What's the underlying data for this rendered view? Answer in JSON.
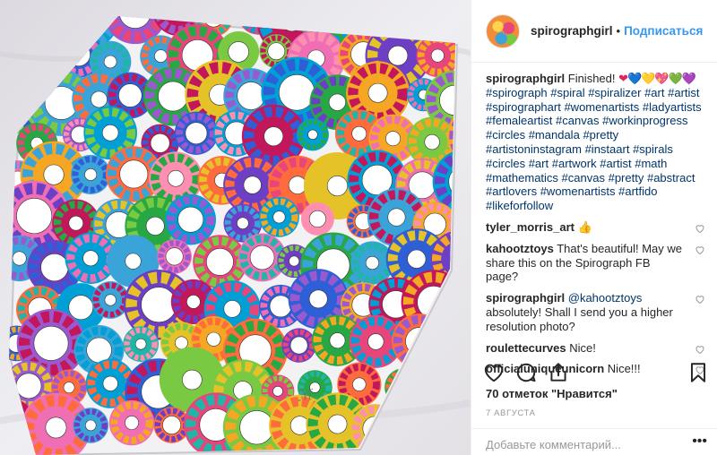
{
  "header": {
    "username": "spirographgirl",
    "separator": "•",
    "follow_label": "Подписаться"
  },
  "caption": {
    "username": "spirographgirl",
    "text": "Finished!",
    "hearts": [
      "❤",
      "💙",
      "💛",
      "💖",
      "💚",
      "💜"
    ],
    "hashtags": [
      "#spirograph",
      "#spiral",
      "#spiralizer",
      "#art",
      "#artist",
      "#spirographart",
      "#womenartists",
      "#ladyartists",
      "#femaleartist",
      "#canvas",
      "#workinprogress",
      "#circles",
      "#mandala",
      "#pretty",
      "#artistoninstagram",
      "#instaart",
      "#spirals",
      "#circles",
      "#art",
      "#artwork",
      "#artist",
      "#math",
      "#mathematics",
      "#canvas",
      "#pretty",
      "#abstract",
      "#artlovers",
      "#womenartists",
      "#artfido",
      "#likeforfollow"
    ]
  },
  "comments": [
    {
      "username": "tyler_morris_art",
      "text": "👍"
    },
    {
      "username": "kahootztoys",
      "text": "That's beautiful! May we share this on the Spirograph FB page?"
    },
    {
      "username": "spirographgirl",
      "mention": "@kahootztoys",
      "text": "absolutely! Shall I send you a higher resolution photo?"
    },
    {
      "username": "roulettecurves",
      "text": "Nice!"
    },
    {
      "username": "officialuniqueunicorn",
      "text": "Nice!!!"
    }
  ],
  "actions": {
    "like_icon": "heart-outline-icon",
    "comment_icon": "speech-bubble-icon",
    "share_icon": "share-icon",
    "save_icon": "bookmark-icon"
  },
  "likes": "70 отметок \"Нравится\"",
  "date": "7 августа",
  "add_comment_placeholder": "Добавьте комментарий...",
  "more_label": "•••",
  "colors": {
    "link_blue": "#3897f0",
    "hashtag_blue": "#003569",
    "text": "#262626",
    "muted": "#999999",
    "border": "#efefef"
  }
}
